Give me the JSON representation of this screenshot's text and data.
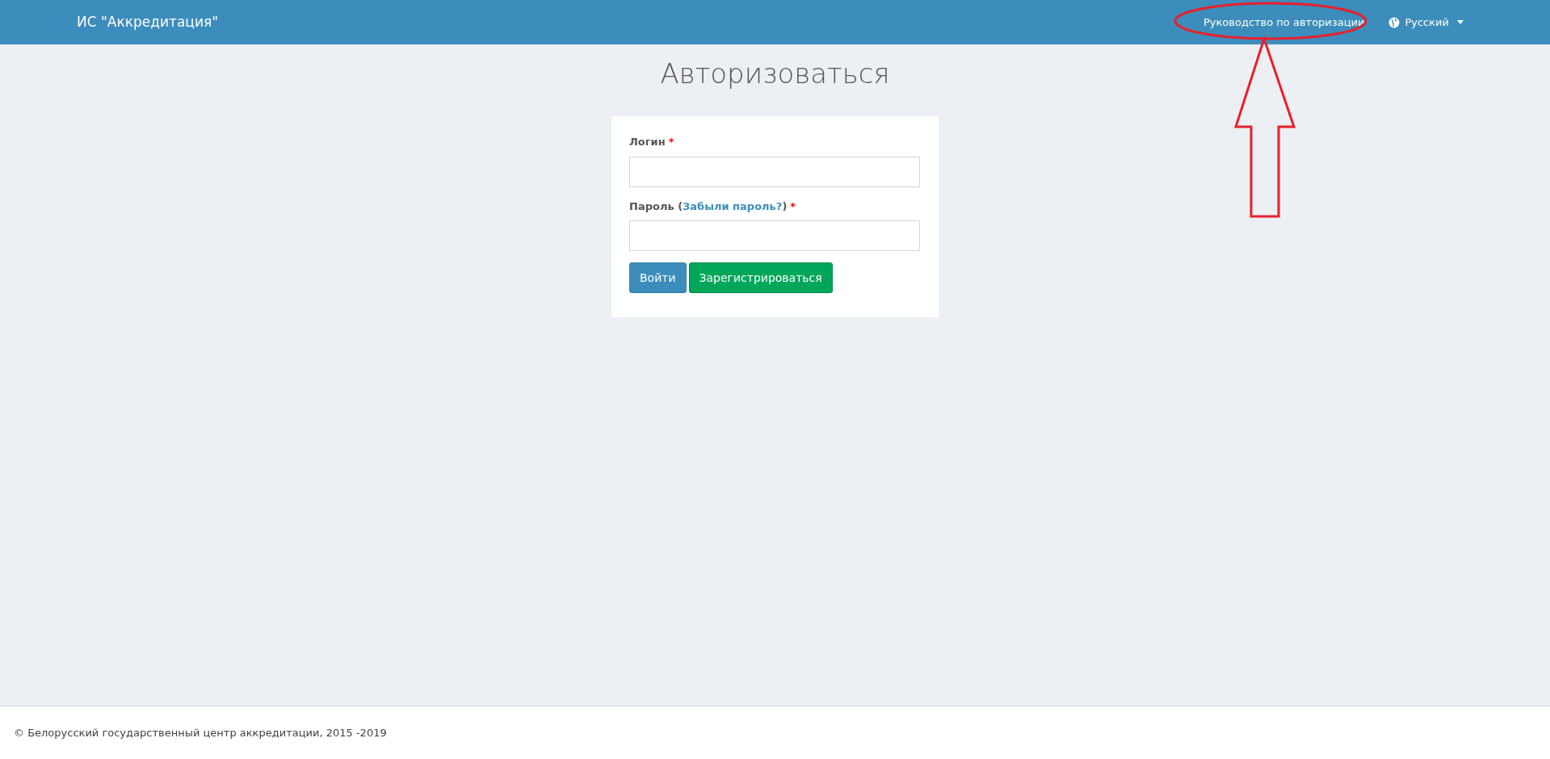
{
  "navbar": {
    "brand": "ИС \"Аккредитация\"",
    "links": [
      {
        "label": "Руководство по авторизации",
        "kind": "link"
      },
      {
        "label": "Русский",
        "kind": "language"
      }
    ]
  },
  "heading": "Авторизоваться",
  "form": {
    "fields": [
      {
        "label": "Логин",
        "required_mark": "*"
      },
      {
        "label": "Пароль",
        "link_prefix": "(",
        "link": "Забыли пароль?",
        "link_suffix": ")",
        "required_mark": "*"
      }
    ],
    "buttons": [
      {
        "label": "Войти",
        "kind": "primary"
      },
      {
        "label": "Зарегистрироваться",
        "kind": "success"
      }
    ]
  },
  "footer": "© Белорусский государственный центр аккредитации, 2015 -2019"
}
